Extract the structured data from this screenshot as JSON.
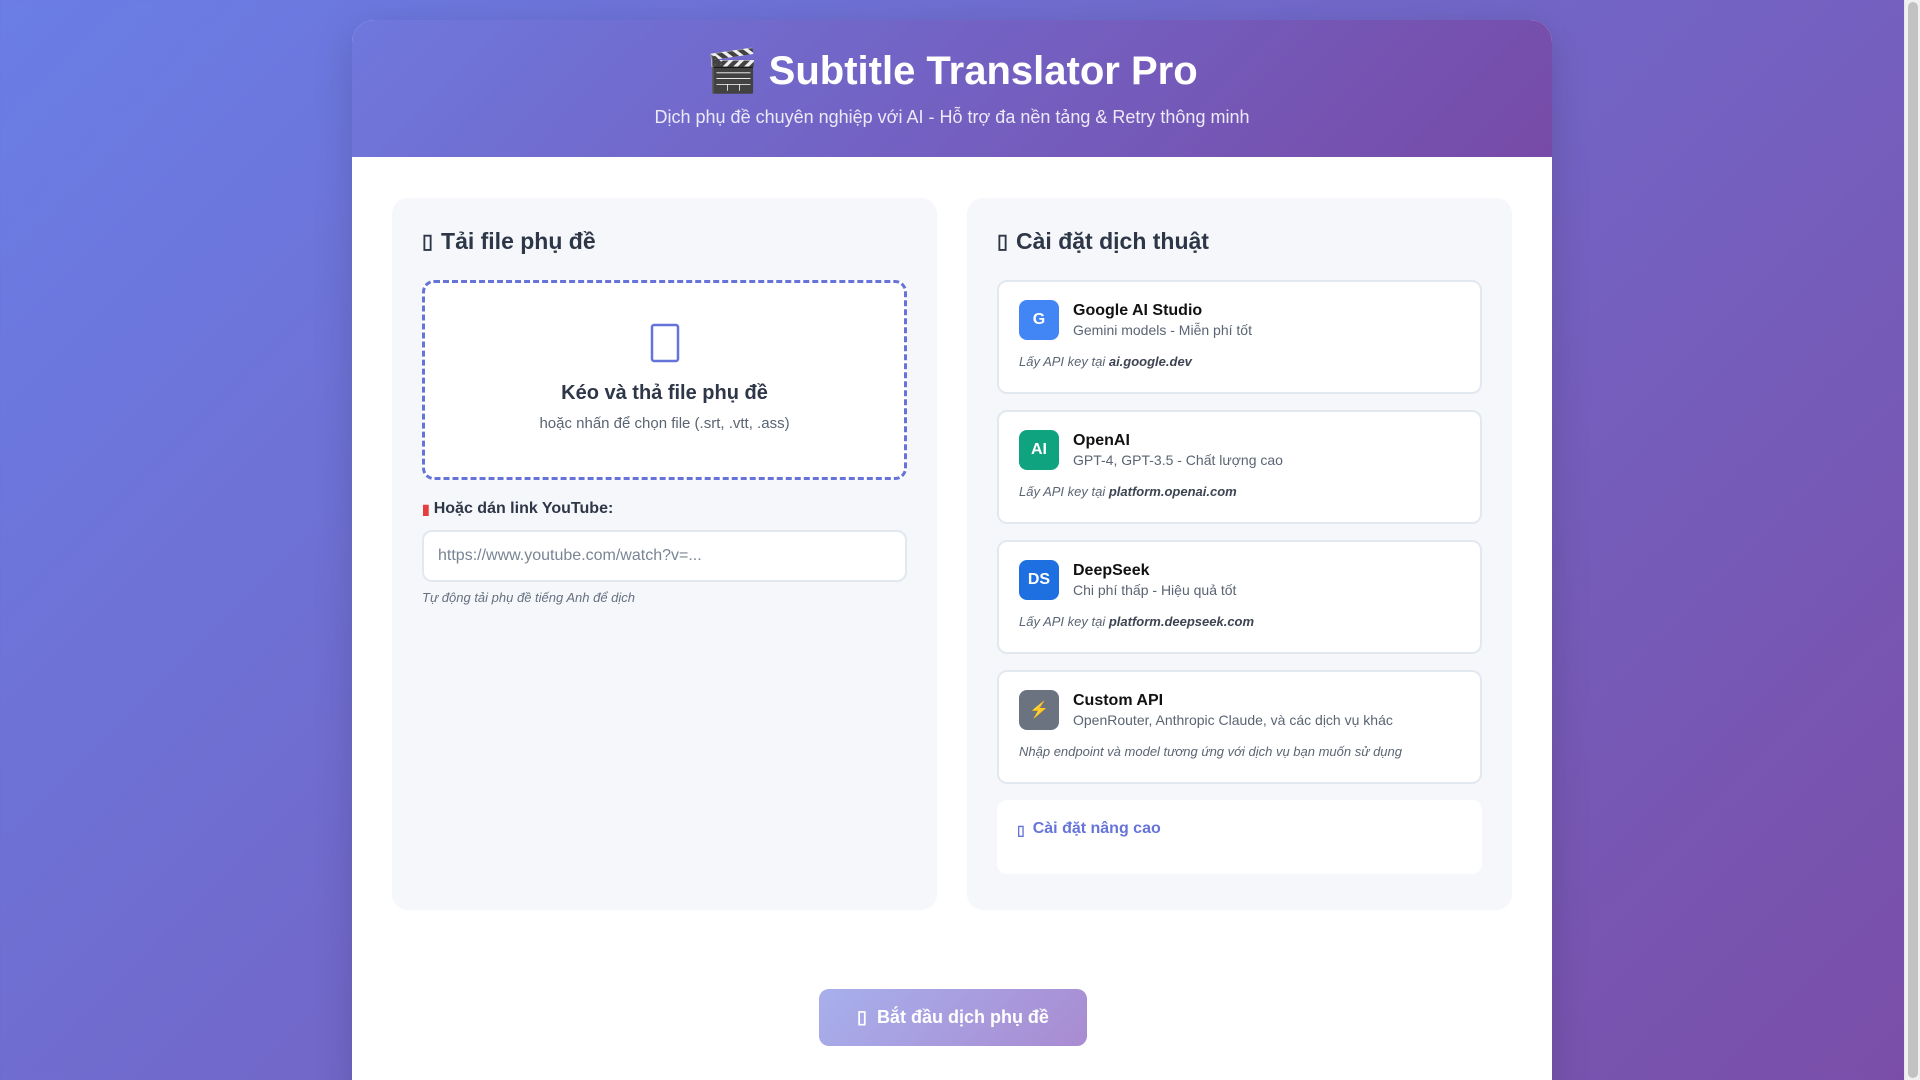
{
  "header": {
    "emoji": "🎬",
    "title": "Subtitle Translator Pro",
    "subtitle": "Dịch phụ đề chuyên nghiệp với AI - Hỗ trợ đa nền tảng & Retry thông minh"
  },
  "upload": {
    "title": "Tải file phụ đề",
    "dropzone_title": "Kéo và thả file phụ đề",
    "dropzone_sub": "hoặc nhấn để chọn file (.srt, .vtt, .ass)",
    "youtube_label": "Hoặc dán link YouTube:",
    "youtube_placeholder": "https://www.youtube.com/watch?v=...",
    "youtube_value": "",
    "youtube_hint": "Tự động tải phụ đề tiếng Anh để dịch"
  },
  "settings": {
    "title": "Cài đặt dịch thuật",
    "providers": [
      {
        "logo": "G",
        "color": "#4285f4",
        "name": "Google AI Studio",
        "desc": "Gemini models - Miễn phí tốt",
        "note_prefix": "Lấy API key tại ",
        "note_link": "ai.google.dev"
      },
      {
        "logo": "AI",
        "color": "#10a37f",
        "name": "OpenAI",
        "desc": "GPT-4, GPT-3.5 - Chất lượng cao",
        "note_prefix": "Lấy API key tại ",
        "note_link": "platform.openai.com"
      },
      {
        "logo": "DS",
        "color": "#1e6fe0",
        "name": "DeepSeek",
        "desc": "Chi phí thấp - Hiệu quả tốt",
        "note_prefix": "Lấy API key tại ",
        "note_link": "platform.deepseek.com"
      },
      {
        "logo": "⚡",
        "color": "#6b7280",
        "name": "Custom API",
        "desc": "OpenRouter, Anthropic Claude, và các dịch vụ khác",
        "note_prefix": "Nhập endpoint và model tương ứng với dịch vụ bạn muốn sử dụng",
        "note_link": ""
      }
    ],
    "advanced_label": "Cài đặt nâng cao"
  },
  "actions": {
    "start_label": "Bắt đầu dịch phụ đề"
  }
}
